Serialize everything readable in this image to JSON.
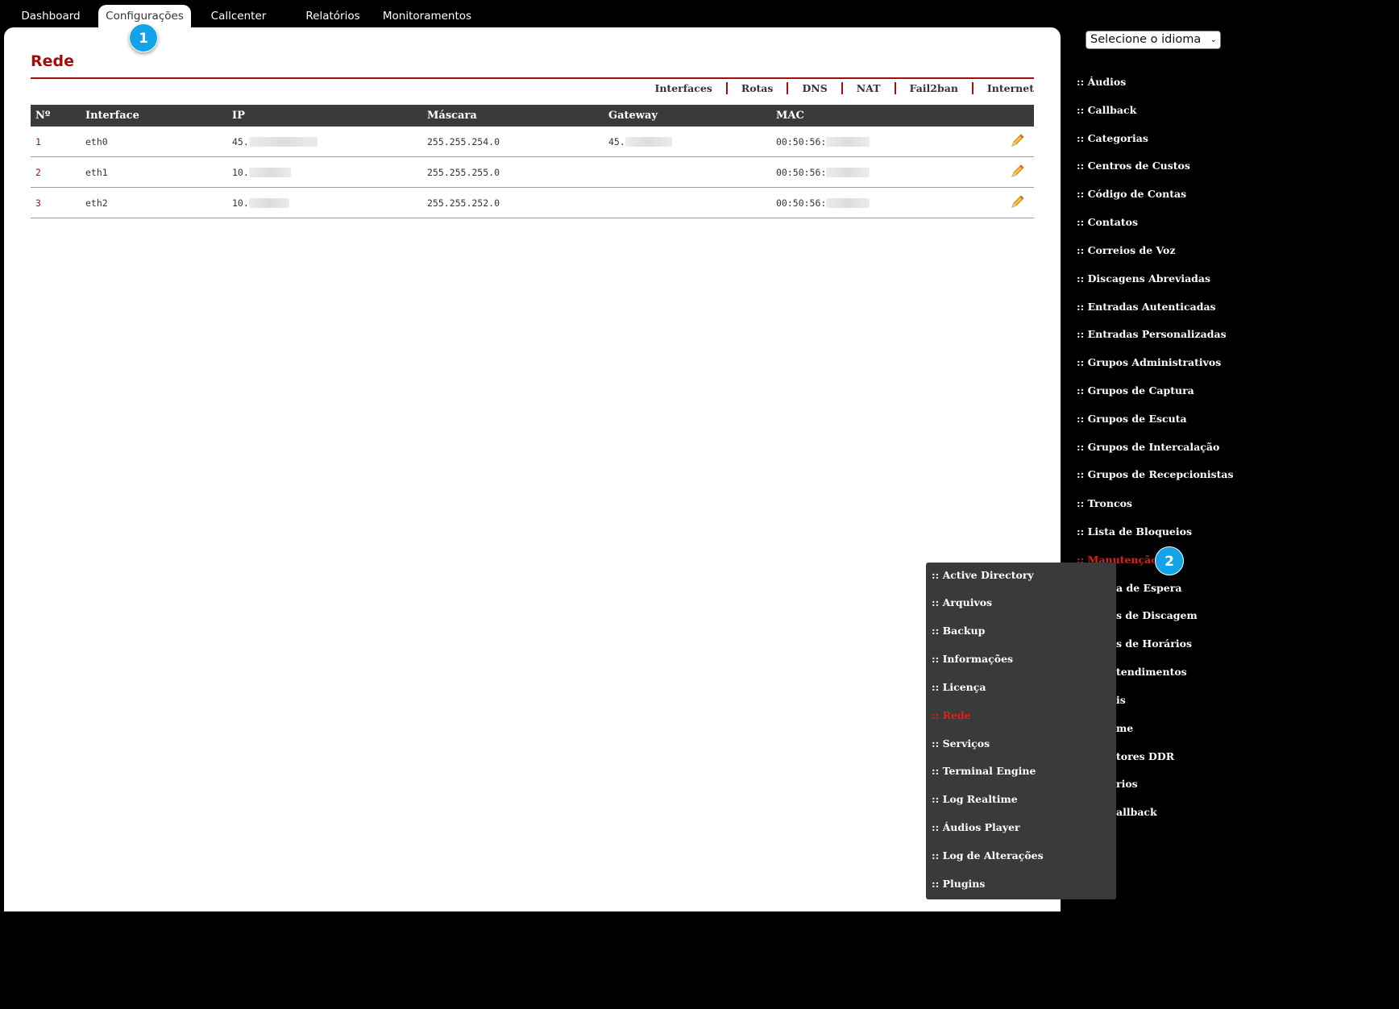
{
  "topnav": {
    "tabs": [
      {
        "label": "Dashboard"
      },
      {
        "label": "Configurações",
        "active": true
      },
      {
        "label": "Callcenter"
      },
      {
        "label": "Relatórios"
      },
      {
        "label": "Monitoramentos"
      }
    ]
  },
  "page": {
    "title": "Rede",
    "subnav": [
      "Interfaces",
      "Rotas",
      "DNS",
      "NAT",
      "Fail2ban",
      "Internet"
    ]
  },
  "table": {
    "headers": [
      "Nº",
      "Interface",
      "IP",
      "Máscara",
      "Gateway",
      "MAC"
    ],
    "rows": [
      {
        "num": "1",
        "iface": "eth0",
        "ip": "45.",
        "mask": "255.255.254.0",
        "gateway": "45.",
        "mac": "00:50:56:"
      },
      {
        "num": "2",
        "iface": "eth1",
        "ip": "10.",
        "mask": "255.255.255.0",
        "gateway": "",
        "mac": "00:50:56:"
      },
      {
        "num": "3",
        "iface": "eth2",
        "ip": "10.",
        "mask": "255.255.252.0",
        "gateway": "",
        "mac": "00:50:56:"
      }
    ]
  },
  "badges": {
    "one": "1",
    "two": "2"
  },
  "language": {
    "selected": "Selecione o idioma"
  },
  "sidebar": {
    "items": [
      ":: Áudios",
      ":: Callback",
      ":: Categorias",
      ":: Centros de Custos",
      ":: Código de Contas",
      ":: Contatos",
      ":: Correios de Voz",
      ":: Discagens Abreviadas",
      ":: Entradas Autenticadas",
      ":: Entradas Personalizadas",
      ":: Grupos Administrativos",
      ":: Grupos de Captura",
      ":: Grupos de Escuta",
      ":: Grupos de Intercalação",
      ":: Grupos de Recepcionistas",
      ":: Troncos",
      ":: Lista de Bloqueios",
      ":: Manutenção"
    ],
    "partial_items": [
      "a de Espera",
      "s de Discagem",
      "s de Horários",
      "tendimentos",
      "is",
      "me",
      "tores DDR",
      "rios",
      "allback"
    ]
  },
  "maintenance_menu": {
    "items": [
      ":: Active Directory",
      ":: Arquivos",
      ":: Backup",
      ":: Informações",
      ":: Licença",
      ":: Rede",
      ":: Serviços",
      ":: Terminal Engine",
      ":: Log Realtime",
      ":: Áudios Player",
      ":: Log de Alterações",
      ":: Plugins"
    ],
    "active_index": 5
  },
  "colors": {
    "accent": "#a50d0d",
    "active_link": "#e0201b",
    "badge": "#13a3e8",
    "header_bg": "#3a3a3a"
  }
}
